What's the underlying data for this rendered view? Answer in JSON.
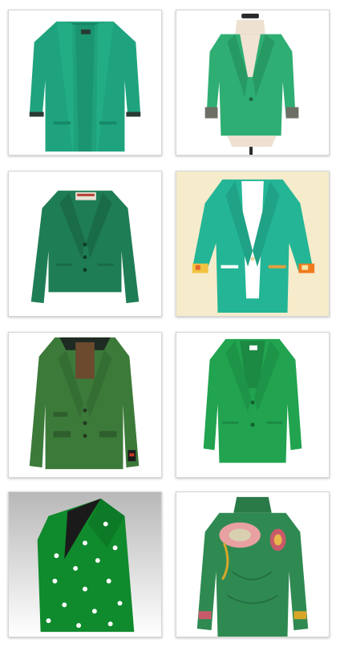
{
  "gallery": {
    "items": [
      {
        "subject": "teal-open-front-blazer",
        "color": "#1fa37e"
      },
      {
        "subject": "green-blazer-on-dress-form",
        "color": "#2fae73"
      },
      {
        "subject": "dark-green-blazer-with-label",
        "color": "#1f7d55"
      },
      {
        "subject": "turquoise-blazer-printed-cuffs",
        "color": "#23b596"
      },
      {
        "subject": "olive-tweed-hacking-jacket",
        "color": "#3c7a3a"
      },
      {
        "subject": "kelly-green-blazer",
        "color": "#21a34f"
      },
      {
        "subject": "shamrock-print-blazer",
        "color": "#0f8a2c"
      },
      {
        "subject": "embroidered-green-jacket",
        "color": "#2f8a52"
      }
    ]
  }
}
